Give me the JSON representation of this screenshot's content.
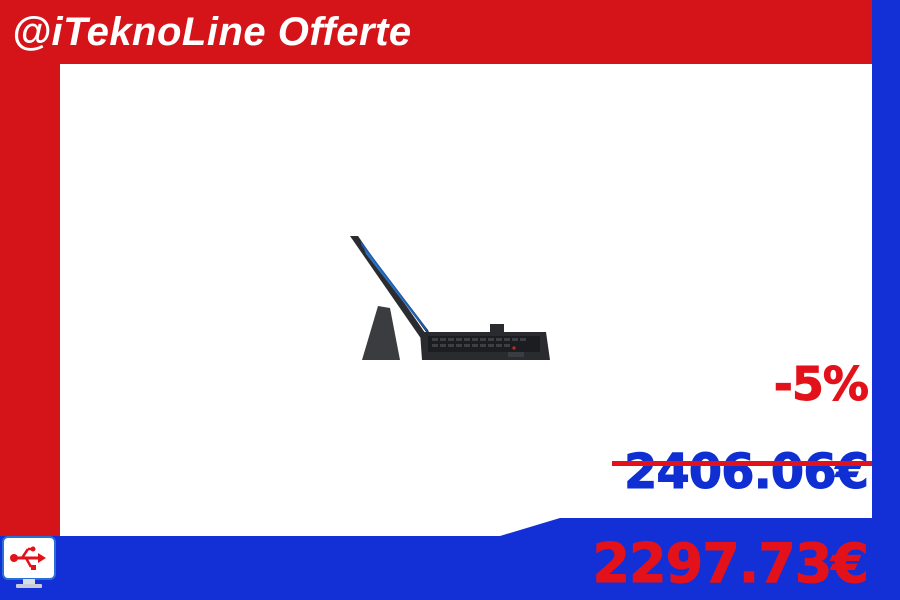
{
  "brand": {
    "title": "@iTeknoLine Offerte"
  },
  "product": {
    "image_alt": "Tablet con tastiera rimovibile"
  },
  "pricing": {
    "discount": "-5%",
    "old_price": "2406.06€",
    "new_price": "2297.73€"
  },
  "logo": {
    "icon": "usb-monitor-icon"
  },
  "colors": {
    "frame_red": "#d41418",
    "frame_blue": "#1230d6",
    "discount_red": "#e3121a",
    "old_price_blue": "#0f2fd2"
  }
}
